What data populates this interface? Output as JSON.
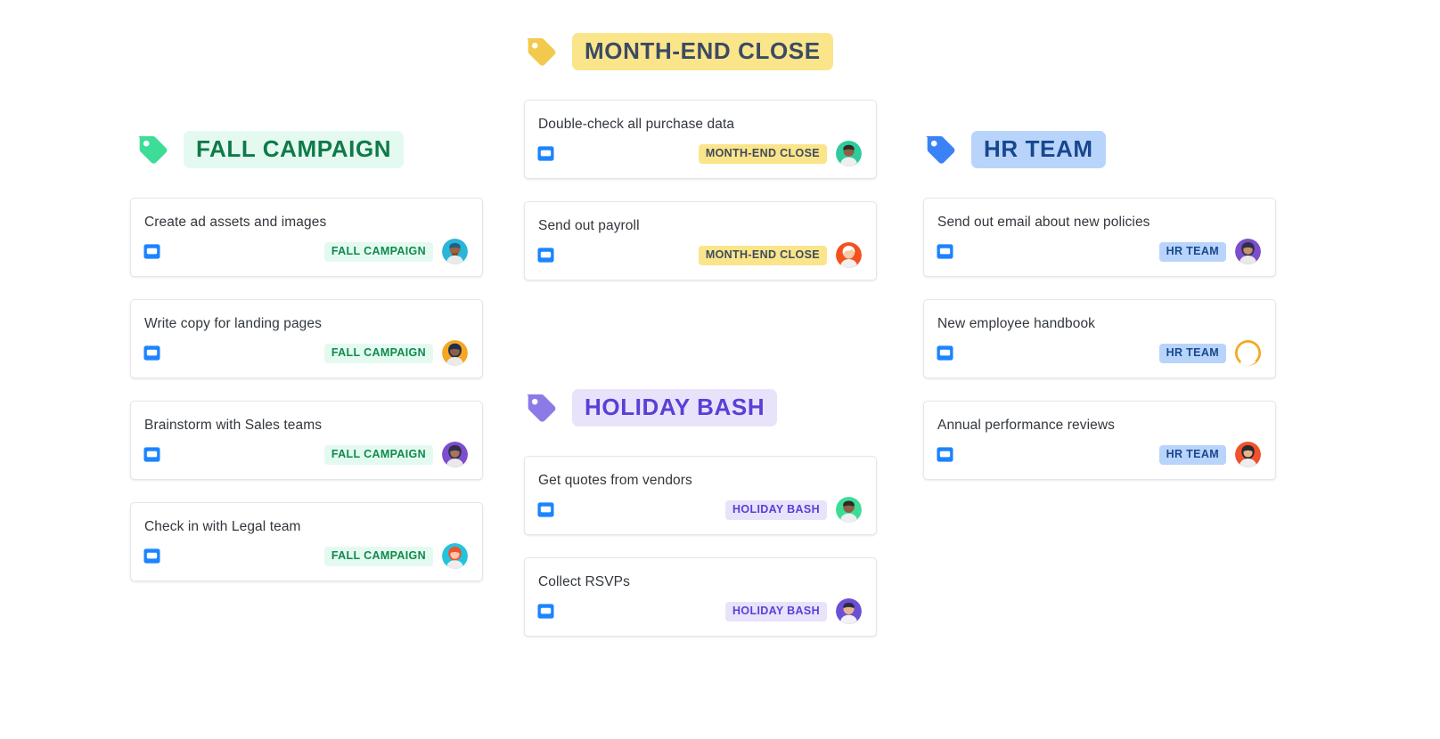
{
  "board": {
    "icons": {
      "group_tag": "tag-icon",
      "card_cover": "board-icon",
      "avatar": "avatar-icon"
    },
    "groups": [
      {
        "id": "month-end-close",
        "name": "MONTH-END CLOSE",
        "tag_color": "#f2c94c",
        "pill_bg": "#fbe58a",
        "pill_text": "#3b4a63",
        "card_pill_bg": "#fbe58a",
        "card_pill_text": "#3d4b5e",
        "cards": [
          {
            "title": "Double-check all purchase data",
            "label": "MONTH-END CLOSE",
            "avatar": {
              "bg": "#2ecc9b",
              "skin": "#8d6043",
              "hair": "#2f2a26",
              "name": "avatar-green"
            }
          },
          {
            "title": "Send out payroll",
            "label": "MONTH-END CLOSE",
            "avatar": {
              "bg": "#f4511e",
              "skin": "#f6c9a8",
              "hair": "#ffffff",
              "name": "avatar-orange"
            }
          }
        ]
      },
      {
        "id": "fall-campaign",
        "name": "FALL CAMPAIGN",
        "tag_color": "#3ddc97",
        "pill_bg": "#e4faf0",
        "pill_text": "#0f7a48",
        "card_pill_bg": "#e4faf0",
        "card_pill_text": "#0f8a4d",
        "cards": [
          {
            "title": "Create ad assets and images",
            "label": "FALL CAMPAIGN",
            "avatar": {
              "bg": "#29b6d8",
              "skin": "#9a6540",
              "hair": "#1f5f8b",
              "name": "avatar-cyan"
            }
          },
          {
            "title": "Write copy for landing pages",
            "label": "FALL CAMPAIGN",
            "avatar": {
              "bg": "#f5a623",
              "skin": "#8d6043",
              "hair": "#1d2f50",
              "name": "avatar-amber"
            }
          },
          {
            "title": "Brainstorm with Sales teams",
            "label": "FALL CAMPAIGN",
            "avatar": {
              "bg": "#7c4dcc",
              "skin": "#a8755a",
              "hair": "#2f2f45",
              "name": "avatar-purple"
            }
          },
          {
            "title": "Check in with Legal team",
            "label": "FALL CAMPAIGN",
            "avatar": {
              "bg": "#22c4dd",
              "skin": "#f6c9a8",
              "hair": "#f2512e",
              "name": "avatar-teal"
            }
          }
        ]
      },
      {
        "id": "holiday-bash",
        "name": "HOLIDAY BASH",
        "tag_color": "#8c7ae6",
        "pill_bg": "#e8e3fb",
        "pill_text": "#5b3fd6",
        "card_pill_bg": "#e8e3fb",
        "card_pill_text": "#5b3fd6",
        "cards": [
          {
            "title": "Get quotes from vendors",
            "label": "HOLIDAY BASH",
            "avatar": {
              "bg": "#3ddc97",
              "skin": "#8d6043",
              "hair": "#2f2a26",
              "name": "avatar-green"
            }
          },
          {
            "title": "Collect RSVPs",
            "label": "HOLIDAY BASH",
            "avatar": {
              "bg": "#6b4fd6",
              "skin": "#e8b48f",
              "hair": "#2b2b3d",
              "name": "avatar-violet"
            }
          }
        ]
      },
      {
        "id": "hr-team",
        "name": "HR TEAM",
        "tag_color": "#3b82f6",
        "pill_bg": "#b9d4fb",
        "pill_text": "#17478f",
        "card_pill_bg": "#b9d4fb",
        "card_pill_text": "#17478f",
        "cards": [
          {
            "title": "Send out email about new policies",
            "label": "HR TEAM",
            "avatar": {
              "bg": "#7c4dcc",
              "skin": "#c89070",
              "hair": "#2f2f45",
              "name": "avatar-purple"
            }
          },
          {
            "title": "New employee handbook",
            "label": "HR TEAM",
            "avatar": {
              "bg": "#f5a623",
              "skin": "#ffffff",
              "hair": "#f5a623",
              "name": "avatar-amber"
            }
          },
          {
            "title": "Annual performance reviews",
            "label": "HR TEAM",
            "avatar": {
              "bg": "#f2512e",
              "skin": "#e8b48f",
              "hair": "#2b2b2b",
              "name": "avatar-red"
            }
          }
        ]
      }
    ]
  }
}
